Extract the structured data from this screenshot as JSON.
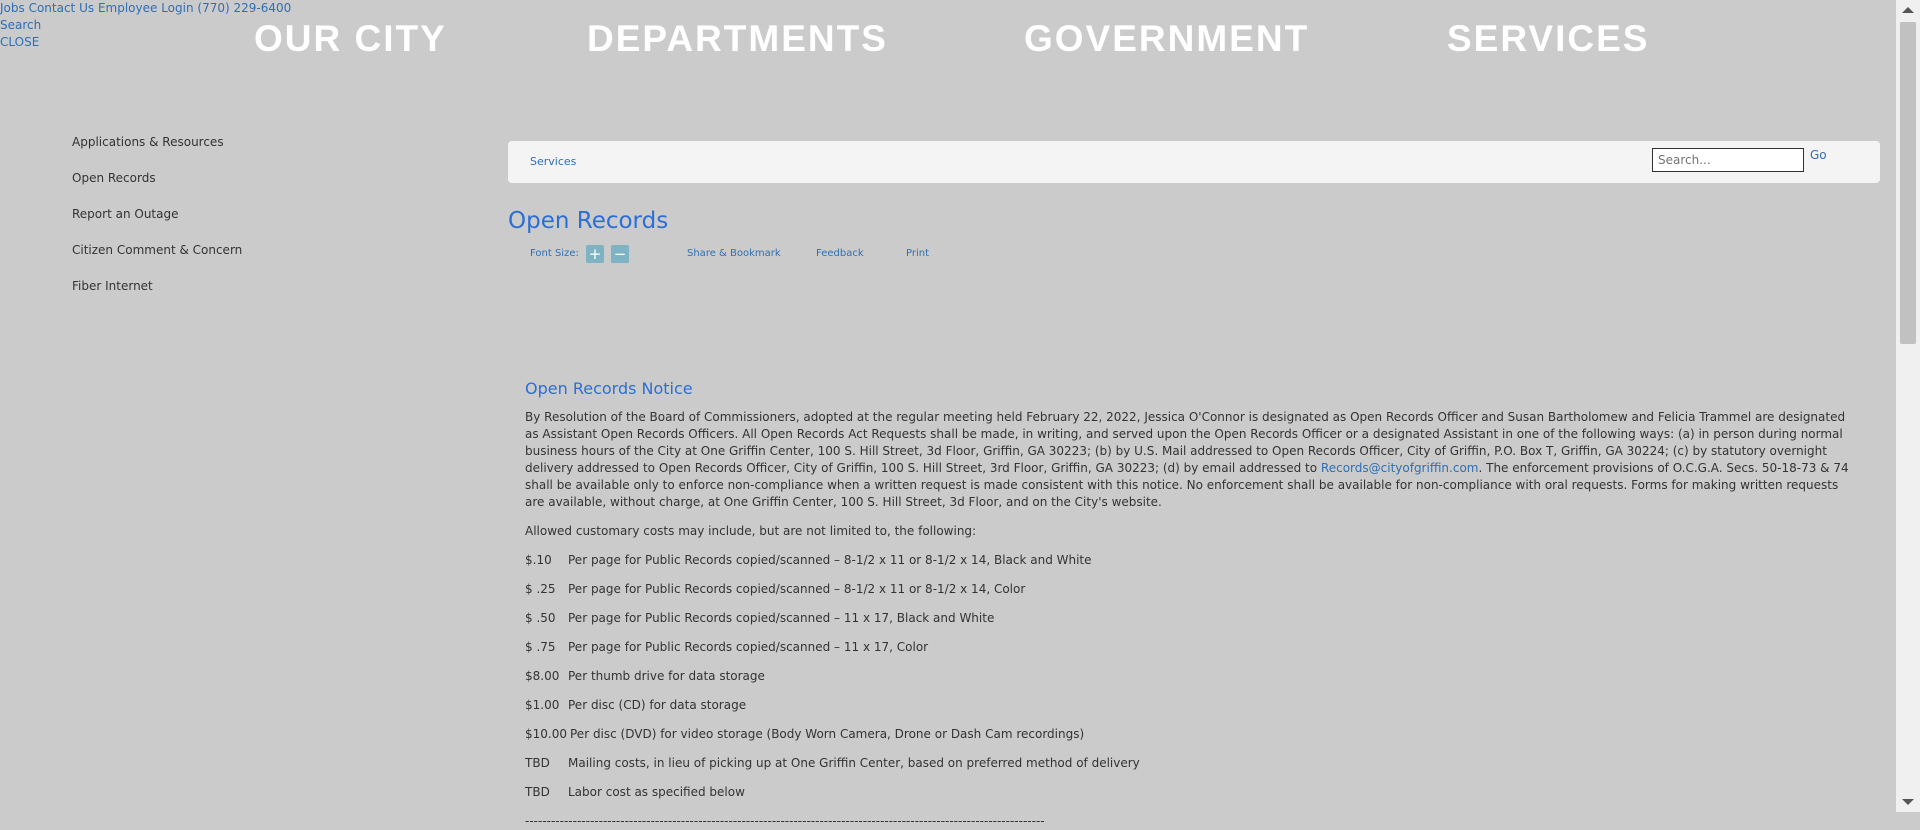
{
  "utility": {
    "jobs": "Jobs",
    "contact": "Contact Us",
    "employee_login": "Employee Login",
    "phone": "(770) 229-6400",
    "search": "Search",
    "close": "CLOSE"
  },
  "nav": [
    "OUR CITY",
    "DEPARTMENTS",
    "GOVERNMENT",
    "SERVICES"
  ],
  "sidebar": [
    "Applications & Resources",
    "Open Records",
    "Report an Outage",
    "Citizen Comment & Concern",
    "Fiber Internet"
  ],
  "breadcrumb": "Services",
  "search": {
    "placeholder": "Search...",
    "go": "Go"
  },
  "page_title": "Open Records",
  "tools": {
    "font_size": "Font Size:",
    "plus": "+",
    "minus": "−",
    "share": "Share & Bookmark",
    "feedback": "Feedback",
    "print": "Print"
  },
  "notice": {
    "title": "Open Records Notice",
    "para_before_email": "By Resolution of the Board of Commissioners, adopted at the regular meeting held February 22, 2022, Jessica O'Connor is designated as Open Records Officer and Susan Bartholomew and Felicia Trammel are designated as Assistant Open Records Officers. All Open Records Act Requests shall be made, in writing, and served upon the Open Records Officer or a designated Assistant in one of the following ways: (a) in person during normal business hours of the City at One Griffin Center, 100 S. Hill Street, 3d Floor, Griffin, GA 30223; (b) by U.S. Mail addressed to Open Records Officer, City of Griffin, P.O. Box T, Griffin, GA 30224; (c) by statutory overnight delivery addressed to Open Records Officer, City of Griffin, 100 S. Hill Street, 3rd Floor, Griffin, GA 30223; (d) by email addressed to",
    "email": "Records@cityofgriffin.com",
    "para_after_email": ". The enforcement provisions of O.C.G.A. Secs. 50-18-73 & 74 shall be available only to enforce non-compliance when a written request is made consistent with this notice. No enforcement shall be available for non-compliance with oral requests. Forms for making written requests are available, without charge, at One Griffin Center, 100 S. Hill Street, 3d Floor, and on the City's website.",
    "costs_intro": "Allowed customary costs may include, but are not limited to, the following:",
    "costs": [
      {
        "amount": "$.10",
        "desc": "Per page for Public Records copied/scanned – 8-1/2 x 11 or 8-1/2 x 14, Black and White"
      },
      {
        "amount": "$ .25",
        "desc": "Per page for Public Records copied/scanned – 8-1/2 x 11 or 8-1/2 x 14, Color"
      },
      {
        "amount": "$ .50",
        "desc": "Per page for Public Records copied/scanned – 11 x 17, Black and White"
      },
      {
        "amount": "$ .75",
        "desc": "Per page for Public Records copied/scanned – 11 x 17, Color"
      },
      {
        "amount": "$8.00",
        "desc": "Per thumb drive for data storage"
      },
      {
        "amount": "$1.00",
        "desc": "Per disc (CD) for data storage"
      },
      {
        "amount": "$10.00",
        "desc": "Per disc (DVD) for video storage (Body Worn Camera, Drone or Dash Cam recordings)"
      },
      {
        "amount": "TBD",
        "desc": "Mailing costs, in lieu of picking up at One Griffin Center, based on preferred method of delivery"
      },
      {
        "amount": "TBD",
        "desc": "Labor cost as specified below"
      }
    ],
    "divider": "------------------------------------------------------------------------------------------------------------------------"
  }
}
